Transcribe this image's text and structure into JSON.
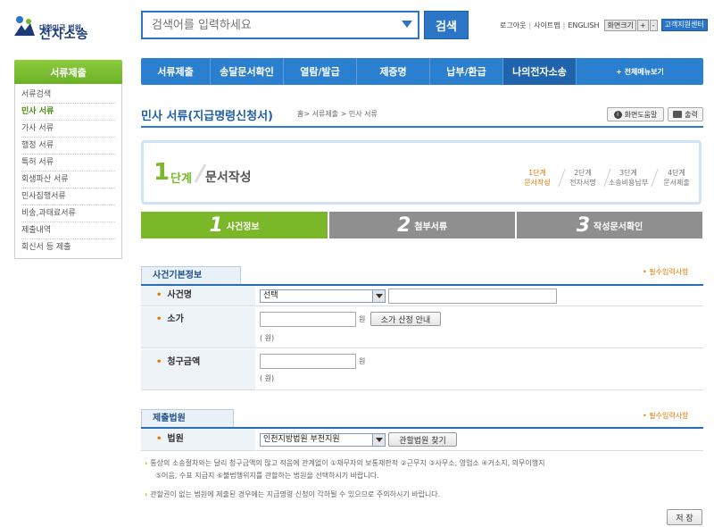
{
  "logo": {
    "sub": "대한민국 법원",
    "main": "전자소송"
  },
  "search": {
    "placeholder": "검색어를 입력하세요",
    "button": "검색"
  },
  "util": {
    "logout": "로그아웃",
    "sitemap": "사이트맵",
    "english": "ENGLISH",
    "font_label": "화면크기",
    "font_plus": "+",
    "font_minus": "-",
    "customer": "고객지원센터"
  },
  "sidebar": {
    "title": "서류제출",
    "items": [
      "서류검색",
      "민사 서류",
      "가사 서류",
      "행정 서류",
      "특허 서류",
      "회생파산 서류",
      "민사집행서류",
      "비송,과태료서류",
      "제출내역",
      "회신서 등 제출"
    ]
  },
  "nav": {
    "tabs": [
      "서류제출",
      "송달문서확인",
      "열람/발급",
      "제증명",
      "납부/환급",
      "나의전자소송"
    ],
    "all_menu": "+ 전체메뉴보기"
  },
  "page": {
    "title": "민사 서류(지급명령신청서)",
    "breadcrumb": "홈> 서류제출 > 민사 서류",
    "help": "화면도움말",
    "print": "출력"
  },
  "step": {
    "num": "1",
    "label": "단계",
    "title": "문서작성",
    "steps": [
      {
        "line1": "1단계",
        "line2": "문서작성"
      },
      {
        "line1": "2단계",
        "line2": "전자서명"
      },
      {
        "line1": "3단계",
        "line2": "소송비용납부"
      },
      {
        "line1": "4단계",
        "line2": "문서제출"
      }
    ]
  },
  "substeps": [
    {
      "num": "1",
      "label": "사건정보"
    },
    {
      "num": "2",
      "label": "첨부서류"
    },
    {
      "num": "3",
      "label": "작성문서확인"
    }
  ],
  "section1": {
    "title": "사건기본정보",
    "required": "• 필수입력사항",
    "case_name": {
      "label": "사건명",
      "select": "선택"
    },
    "claim": {
      "label": "소가",
      "unit": "원",
      "button": "소가 산정 안내",
      "hint": "( 원)"
    },
    "amount": {
      "label": "청구금액",
      "unit": "원",
      "hint": "( 원)"
    }
  },
  "section2": {
    "title": "제출법원",
    "required": "• 필수입력사항",
    "court": {
      "label": "법원",
      "select": "인천지방법원 부천지원",
      "button": "관할법원 찾기"
    }
  },
  "notes": [
    "통상의 소송절차와는 달리 청구금액의 많고 적음에 관계없이 ①채무자의 보통재판적 ②근무지 ③사무소, 영업소 ④거소지, 의무이행지",
    "⑤어음, 수표 지급지 ⑥불법행위지를 관할하는 법원을 선택하시기 바랍니다.",
    "관할권이 없는 법원에 제출된 경우에는 지급명령 신청이 각하될 수 있으므로 주의하시기 바랍니다."
  ],
  "save": "저 장",
  "colors": {
    "brand_blue": "#2b7fcf",
    "green": "#7ab829",
    "orange": "#e07b00"
  }
}
